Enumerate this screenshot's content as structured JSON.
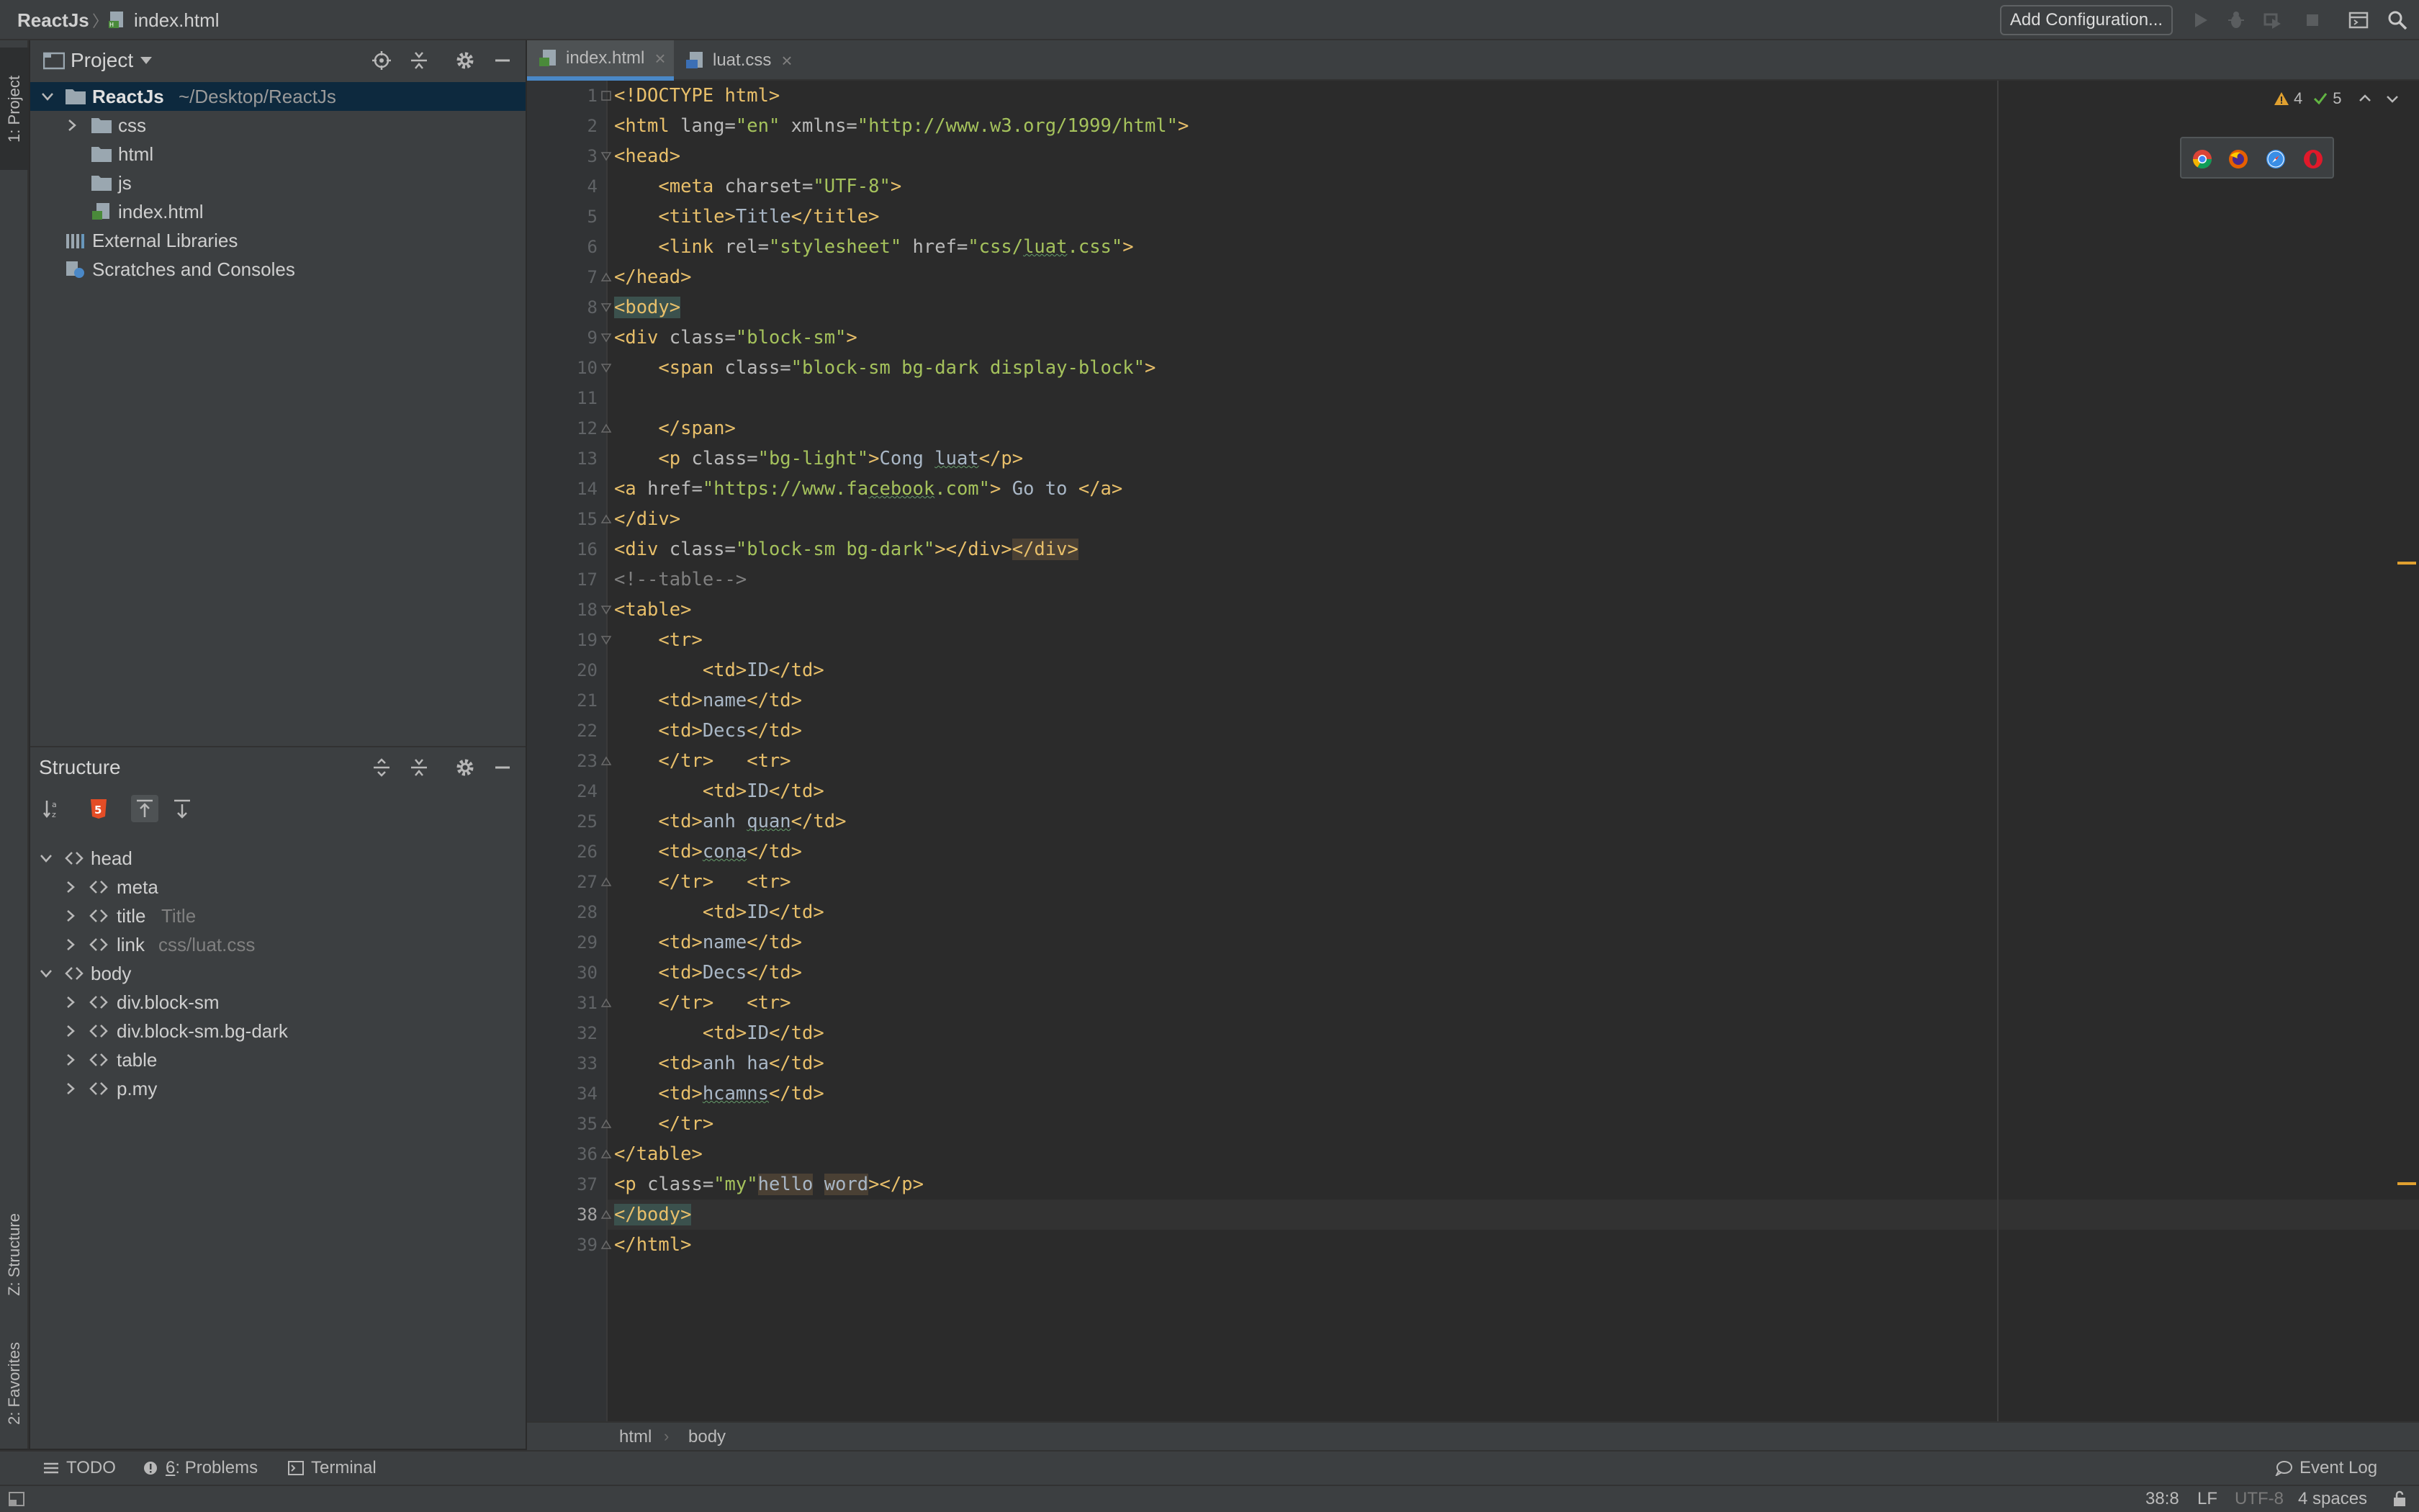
{
  "navbar": {
    "project": "ReactJs",
    "separator": "〉",
    "file": "index.html",
    "add_config": "Add Configuration..."
  },
  "left_strip": {
    "project_tab": "1: Project",
    "structure_tab": "Z: Structure",
    "favorites_tab": "2: Favorites"
  },
  "project_panel": {
    "title": "Project",
    "tree": [
      {
        "label": "ReactJs",
        "path": "~/Desktop/ReactJs"
      },
      {
        "label": "css"
      },
      {
        "label": "html"
      },
      {
        "label": "js"
      },
      {
        "label": "index.html"
      },
      {
        "label": "External Libraries"
      },
      {
        "label": "Scratches and Consoles"
      }
    ]
  },
  "structure_panel": {
    "title": "Structure",
    "tree": [
      {
        "label": "head",
        "hint": ""
      },
      {
        "label": "meta",
        "hint": ""
      },
      {
        "label": "title",
        "hint": "Title"
      },
      {
        "label": "link",
        "hint": "css/luat.css"
      },
      {
        "label": "body",
        "hint": ""
      },
      {
        "label": "div.block-sm",
        "hint": ""
      },
      {
        "label": "div.block-sm.bg-dark",
        "hint": ""
      },
      {
        "label": "table",
        "hint": ""
      },
      {
        "label": "p.my",
        "hint": ""
      }
    ]
  },
  "editor": {
    "tabs": [
      {
        "label": "index.html"
      },
      {
        "label": "luat.css"
      }
    ],
    "warnings": "4",
    "checks": "5",
    "breadcrumb": [
      "html",
      "body"
    ]
  },
  "code_lines": [
    {
      "n": "1"
    },
    {
      "n": "2"
    },
    {
      "n": "3"
    },
    {
      "n": "4"
    },
    {
      "n": "5"
    },
    {
      "n": "6"
    },
    {
      "n": "7"
    },
    {
      "n": "8"
    },
    {
      "n": "9"
    },
    {
      "n": "10"
    },
    {
      "n": "11"
    },
    {
      "n": "12"
    },
    {
      "n": "13"
    },
    {
      "n": "14"
    },
    {
      "n": "15"
    },
    {
      "n": "16"
    },
    {
      "n": "17"
    },
    {
      "n": "18"
    },
    {
      "n": "19"
    },
    {
      "n": "20"
    },
    {
      "n": "21"
    },
    {
      "n": "22"
    },
    {
      "n": "23"
    },
    {
      "n": "24"
    },
    {
      "n": "25"
    },
    {
      "n": "26"
    },
    {
      "n": "27"
    },
    {
      "n": "28"
    },
    {
      "n": "29"
    },
    {
      "n": "30"
    },
    {
      "n": "31"
    },
    {
      "n": "32"
    },
    {
      "n": "33"
    },
    {
      "n": "34"
    },
    {
      "n": "35"
    },
    {
      "n": "36"
    },
    {
      "n": "37"
    },
    {
      "n": "38"
    },
    {
      "n": "39"
    }
  ],
  "code": {
    "l1": "<!DOCTYPE html>",
    "l2a": "<html ",
    "l2b": "lang=",
    "l2c": "\"en\"",
    "l2d": " xmlns=",
    "l2e": "\"http://www.w3.org/1999/html\"",
    "l2f": ">",
    "l3": "<head>",
    "l4a": "    <meta ",
    "l4b": "charset=",
    "l4c": "\"UTF-8\"",
    "l4d": ">",
    "l5a": "    <title>",
    "l5b": "Title",
    "l5c": "</title>",
    "l6a": "    <link ",
    "l6b": "rel=",
    "l6c": "\"stylesheet\"",
    "l6d": " href=",
    "l6e": "\"css/",
    "l6f": "luat",
    "l6g": ".css\"",
    "l6h": ">",
    "l7": "</head>",
    "l8": "<body>",
    "l9a": "<div ",
    "l9b": "class=",
    "l9c": "\"block-sm\"",
    "l9d": ">",
    "l10a": "    <span ",
    "l10b": "class=",
    "l10c": "\"block-sm bg-dark display-block\"",
    "l10d": ">",
    "l12": "    </span>",
    "l13a": "    <p ",
    "l13b": "class=",
    "l13c": "\"bg-light\"",
    "l13d": ">",
    "l13e": "Cong ",
    "l13f": "luat",
    "l13g": "</p>",
    "l14a": "<a ",
    "l14b": "href=",
    "l14c": "\"https://www.fa",
    "l14d": "cebook",
    "l14e": ".com\"",
    "l14f": ">",
    "l14g": " Go to ",
    "l14h": "</a>",
    "l15": "</div>",
    "l16a": "<div ",
    "l16b": "class=",
    "l16c": "\"block-sm bg-dark\"",
    "l16d": "></div>",
    "l16e": "</div>",
    "l17": "<!--table-->",
    "l18": "<table>",
    "l19": "    <tr>",
    "l20a": "        <td>",
    "l20b": "ID",
    "l20c": "</td>",
    "l21a": "    <td>",
    "l21b": "name",
    "l21c": "</td>",
    "l22a": "    <td>",
    "l22b": "Decs",
    "l22c": "</td>",
    "l23a": "    </tr>",
    "l23b": "   <tr>",
    "l24a": "        <td>",
    "l24b": "ID",
    "l24c": "</td>",
    "l25a": "    <td>",
    "l25b": "anh ",
    "l25c": "quan",
    "l25d": "</td>",
    "l26a": "    <td>",
    "l26b": "cona",
    "l26c": "</td>",
    "l27a": "    </tr>",
    "l27b": "   <tr>",
    "l28a": "        <td>",
    "l28b": "ID",
    "l28c": "</td>",
    "l29a": "    <td>",
    "l29b": "name",
    "l29c": "</td>",
    "l30a": "    <td>",
    "l30b": "Decs",
    "l30c": "</td>",
    "l31a": "    </tr>",
    "l31b": "   <tr>",
    "l32a": "        <td>",
    "l32b": "ID",
    "l32c": "</td>",
    "l33a": "    <td>",
    "l33b": "anh ha",
    "l33c": "</td>",
    "l34a": "    <td>",
    "l34b": "hcamns",
    "l34c": "</td>",
    "l35": "    </tr>",
    "l36": "</table>",
    "l37a": "<p ",
    "l37b": "class=",
    "l37c": "\"my\"",
    "l37d": "hello",
    "l37e": " ",
    "l37f": "word",
    "l37g": "></p>",
    "l38": "</body>",
    "l39": "</html>"
  },
  "bottom_bar": {
    "todo": "TODO",
    "problems_num": "6",
    "problems": ": Problems",
    "terminal": "Terminal",
    "event_log": "Event Log"
  },
  "status": {
    "position": "38:8",
    "line_sep": "LF",
    "encoding": "UTF-8",
    "indent": "4 spaces"
  },
  "colors": {
    "accent": "#4a88c7",
    "tag": "#e8bf6a",
    "string": "#a5c25c",
    "warning": "#e0a030"
  }
}
